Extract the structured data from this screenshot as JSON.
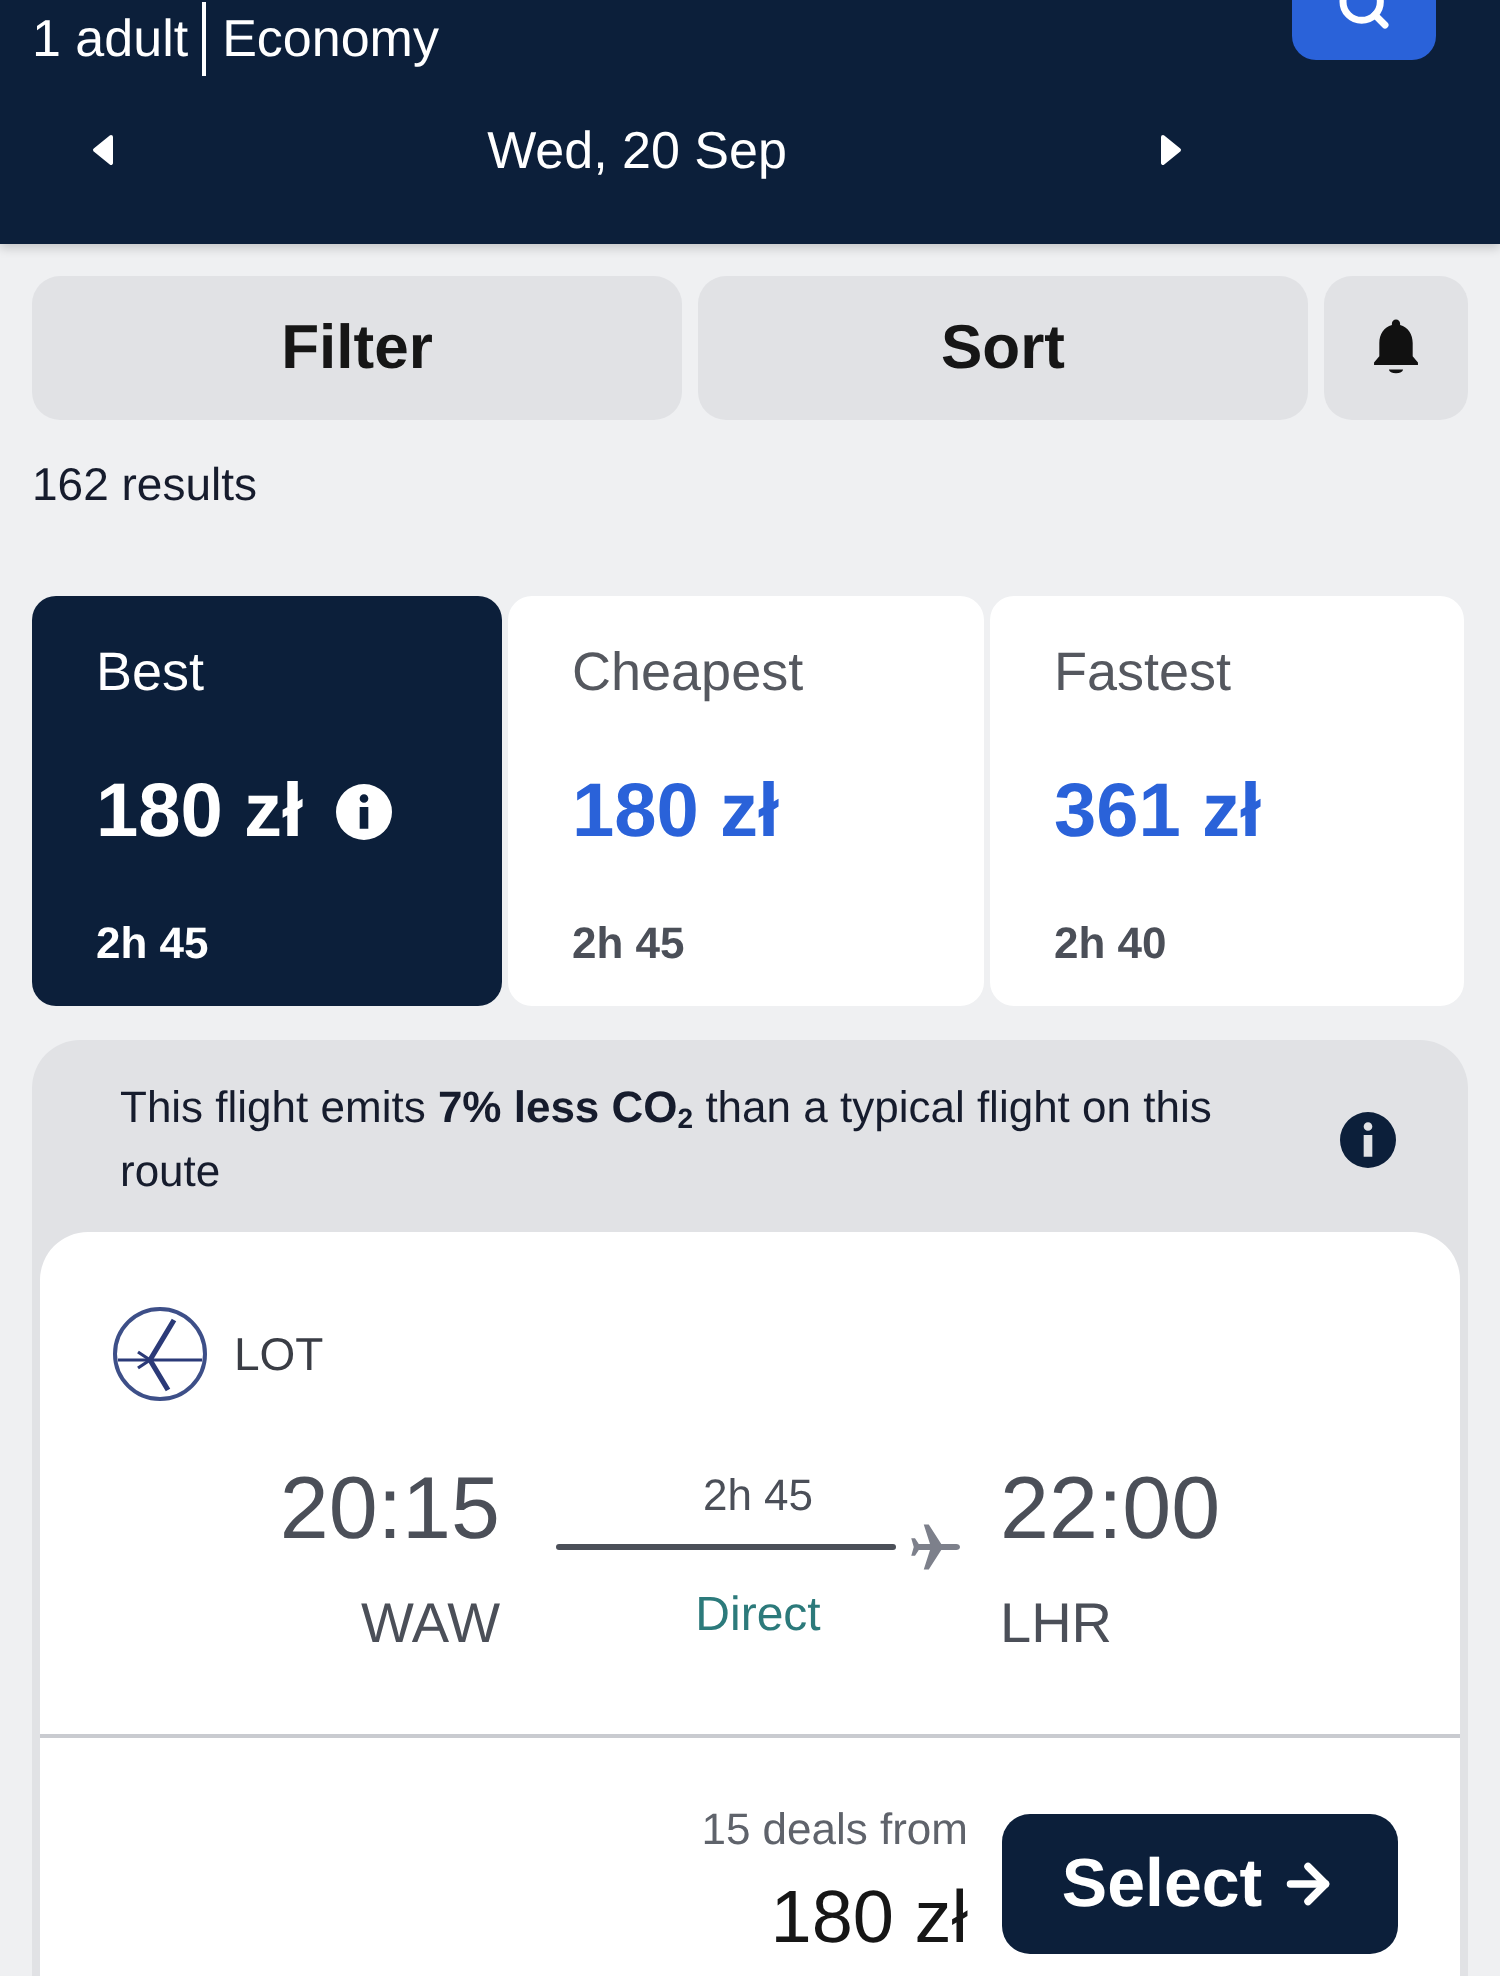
{
  "header": {
    "passengers": "1 adult",
    "cabin_class": "Economy",
    "date": "Wed, 20 Sep"
  },
  "toolbar": {
    "filter": "Filter",
    "sort": "Sort"
  },
  "results_count": "162 results",
  "sort_tabs": [
    {
      "label": "Best",
      "price": "180 zł",
      "duration": "2h 45",
      "selected": true,
      "info_icon": true
    },
    {
      "label": "Cheapest",
      "price": "180 zł",
      "duration": "2h 45",
      "selected": false
    },
    {
      "label": "Fastest",
      "price": "361 zł",
      "duration": "2h 40",
      "selected": false
    }
  ],
  "eco_notice": {
    "text": "This flight emits **7% less CO$_{2}$** than a typical flight on this route"
  },
  "flight": {
    "airline": "LOT",
    "departure": {
      "time": "20:15",
      "airport": "WAW"
    },
    "duration": "2h 45",
    "stops": "Direct",
    "arrival": {
      "time": "22:00",
      "airport": "LHR"
    },
    "deals": "15 deals from",
    "price": "180 zł",
    "action": "Select"
  }
}
